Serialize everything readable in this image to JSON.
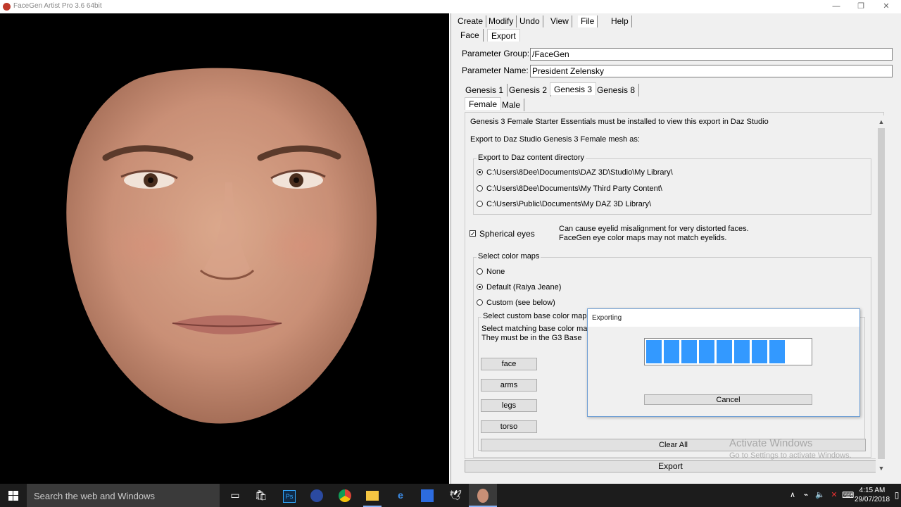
{
  "window": {
    "title": "FaceGen Artist Pro 3.6 64bit",
    "controls": [
      "—",
      "❐",
      "✕"
    ]
  },
  "menu": [
    "Create",
    "Modify",
    "Undo",
    "View",
    "File",
    "Help"
  ],
  "subtabs": [
    "Face",
    "Export"
  ],
  "params": {
    "group_label": "Parameter Group:",
    "group_value": "/FaceGen",
    "name_label": "Parameter Name:",
    "name_value": "President Zelensky"
  },
  "genesis_tabs": [
    "Genesis 1",
    "Genesis 2",
    "Genesis 3",
    "Genesis 8"
  ],
  "gender_tabs": [
    "Female",
    "Male"
  ],
  "content": {
    "notice": "Genesis 3 Female Starter Essentials must be installed to view this export in Daz Studio",
    "export_to": "Export to Daz Studio Genesis 3 Female mesh as:",
    "dir_group_title": "Export to Daz content directory",
    "dirs": [
      "C:\\Users\\8Dee\\Documents\\DAZ 3D\\Studio\\My Library\\",
      "C:\\Users\\8Dee\\Documents\\My Third Party Content\\",
      "C:\\Users\\Public\\Documents\\My DAZ 3D Library\\"
    ],
    "spherical_label": "Spherical eyes",
    "spherical_note_1": "Can cause eyelid misalignment for very distorted faces.",
    "spherical_note_2": "FaceGen eye color maps may not match eyelids.",
    "colormap_title": "Select color maps",
    "colormaps": [
      "None",
      "Default (Raiya Jeane)",
      "Custom (see below)"
    ],
    "custom_title": "Select custom base color map",
    "custom_note_1": "Select matching base color ma",
    "custom_note_2": "They must be in the G3 Base",
    "map_buttons": [
      "face",
      "arms",
      "legs",
      "torso"
    ],
    "clear_all": "Clear All",
    "export": "Export"
  },
  "dialog": {
    "title": "Exporting",
    "cancel": "Cancel",
    "progress_segments_filled": 8,
    "progress_segments_total": 9
  },
  "watermark": {
    "line1": "Activate Windows",
    "line2": "Go to Settings to activate Windows."
  },
  "taskbar": {
    "search_placeholder": "Search the web and Windows",
    "time": "4:15 AM",
    "date": "29/07/2018"
  },
  "colors": {
    "progress": "#3399ff",
    "taskbar": "#1c1c1c"
  }
}
